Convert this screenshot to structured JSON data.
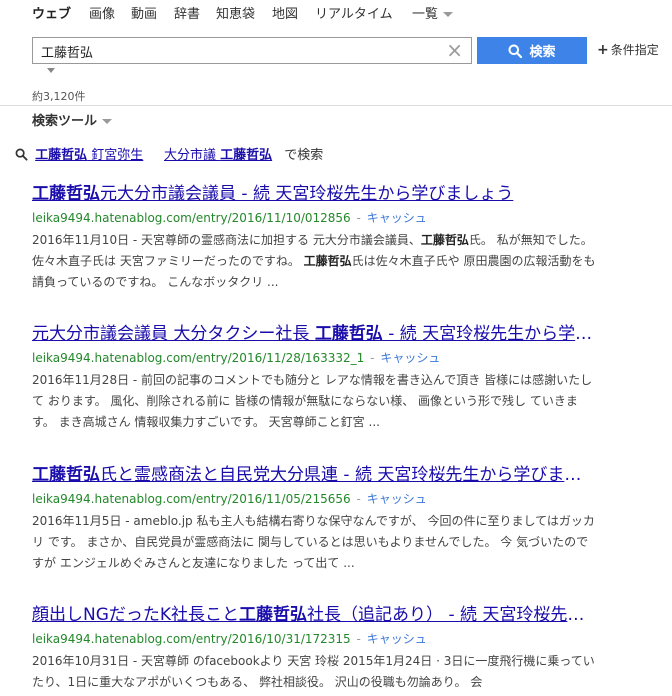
{
  "tabs": [
    {
      "label": "ウェブ"
    },
    {
      "label": "画像"
    },
    {
      "label": "動画"
    },
    {
      "label": "辞書"
    },
    {
      "label": "知恵袋"
    },
    {
      "label": "地図"
    },
    {
      "label": "リアルタイム"
    },
    {
      "label": "一覧"
    }
  ],
  "search": {
    "query": "工藤哲弘",
    "button_label": "検索",
    "clear_icon": "×"
  },
  "conditions": {
    "plus": "+",
    "label": "条件指定"
  },
  "result_count": "約3,120件",
  "tools_label": "検索ツール",
  "related": {
    "items": [
      {
        "query": "工藤哲弘",
        "extra": " 釘宮弥生"
      },
      {
        "extra_first": "大分市議 ",
        "query": "工藤哲弘"
      }
    ],
    "suffix": "で検索"
  },
  "cache_label": "キャッシュ",
  "separator": "-",
  "results": [
    {
      "title_bold": "工藤哲弘",
      "title_rest": "元大分市議会議員 - 続 天宮玲桜先生から学びましょう",
      "url": "leika9494.hatenablog.com/entry/2016/11/10/012856",
      "snippet_a": "2016年11月10日 - 天宮尊師の霊感商法に加担する 元大分市議会議員、",
      "snippet_b": "工藤哲弘",
      "snippet_c": "氏。 私が無知でした。 佐々木直子氏は 天宮ファミリーだったのですね。 ",
      "snippet_d": "工藤哲弘",
      "snippet_e": "氏は佐々木直子氏や 原田農園の広報活動をも 請負っているのですね。 こんなボッタクリ ..."
    },
    {
      "title_pre": "元大分市議会議員 大分タクシー社長 ",
      "title_bold": "工藤哲弘",
      "title_rest": " - 続 天宮玲桜先生から学びましょう",
      "url": "leika9494.hatenablog.com/entry/2016/11/28/163332_1",
      "snippet": "2016年11月28日 - 前回の記事のコメントでも随分と レアな情報を書き込んで頂き 皆様には感謝いたして おります。 風化、削除される前に 皆様の情報が無駄にならない様、 画像という形で残し ていきます。 まき高城さん 情報収集力すごいです。 天宮尊師こと釘宮 ..."
    },
    {
      "title_bold": "工藤哲弘",
      "title_rest": "氏と霊感商法と自民党大分県連 - 続 天宮玲桜先生から学びましょう",
      "url": "leika9494.hatenablog.com/entry/2016/11/05/215656",
      "snippet": "2016年11月5日 - ameblo.jp 私も主人も結構右寄りな保守なんですが、 今回の件に至りましてはガッカリ です。 まさか、自民党員が霊感商法に 関与しているとは思いもよりませんでした。 今 気づいたのですが エンジェルめぐみさんと友達になりました って出て ..."
    },
    {
      "title_pre": "顔出しNGだったK社長こと",
      "title_bold": "工藤哲弘",
      "title_rest": "社長（追記あり） - 続 天宮玲桜先生から学びましょう",
      "url": "leika9494.hatenablog.com/entry/2016/10/31/172315",
      "snippet": "2016年10月31日 - 天宮尊師 のfacebookより 天宮 玲桜 2015年1月24日 · 3日に一度飛行機に乗ってい たり、1日に重大なアポがいくつもある、 弊社相談役。 沢山の役職も勿論あり。 会"
    }
  ],
  "colors": {
    "link": "#1a0dab",
    "url_green": "#23882a",
    "button_blue": "#3e84e8"
  }
}
